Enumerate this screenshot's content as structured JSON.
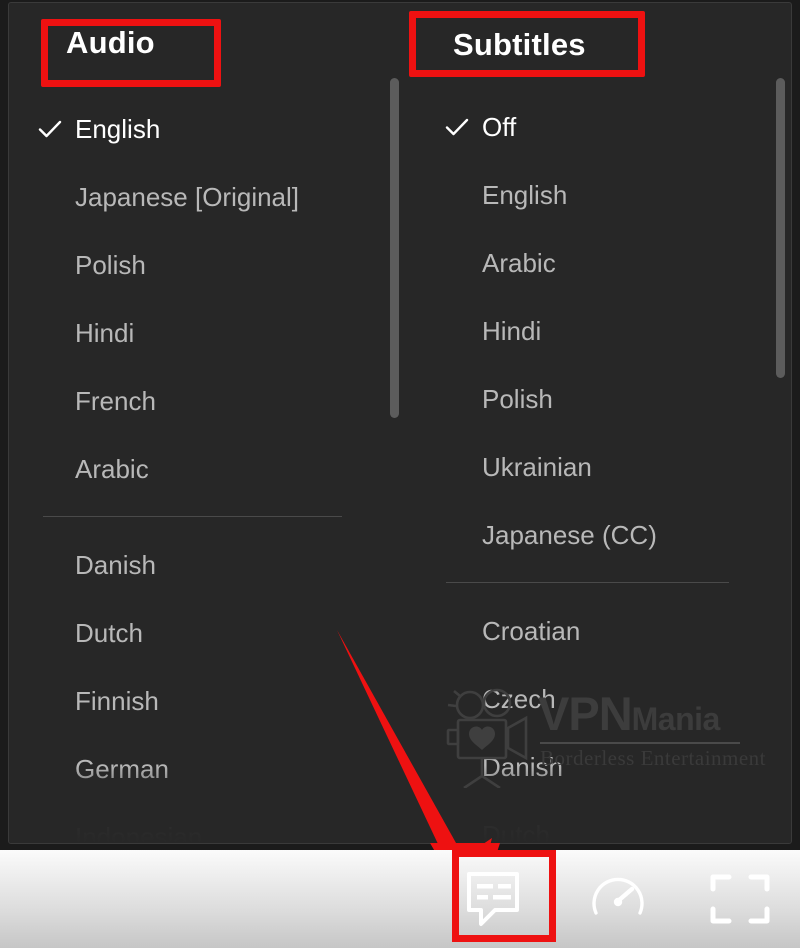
{
  "window": {
    "background_color": "#1b1b1b",
    "panel_color": "#272727",
    "accent_color": "#ee1111"
  },
  "audio_panel": {
    "title": "Audio",
    "selected": "English",
    "primary_options": [
      {
        "label": "English",
        "selected": true
      },
      {
        "label": "Japanese [Original]",
        "selected": false
      },
      {
        "label": "Polish",
        "selected": false
      },
      {
        "label": "Hindi",
        "selected": false
      },
      {
        "label": "French",
        "selected": false
      },
      {
        "label": "Arabic",
        "selected": false
      }
    ],
    "secondary_options": [
      {
        "label": "Danish",
        "selected": false,
        "faded": false
      },
      {
        "label": "Dutch",
        "selected": false,
        "faded": false
      },
      {
        "label": "Finnish",
        "selected": false,
        "faded": false
      },
      {
        "label": "German",
        "selected": false,
        "faded": false
      },
      {
        "label": "Indonesian",
        "selected": false,
        "faded": true
      }
    ]
  },
  "subtitles_panel": {
    "title": "Subtitles",
    "selected": "Off",
    "primary_options": [
      {
        "label": "Off",
        "selected": true
      },
      {
        "label": "English",
        "selected": false
      },
      {
        "label": "Arabic",
        "selected": false
      },
      {
        "label": "Hindi",
        "selected": false
      },
      {
        "label": "Polish",
        "selected": false
      },
      {
        "label": "Ukrainian",
        "selected": false
      },
      {
        "label": "Japanese (CC)",
        "selected": false
      }
    ],
    "secondary_options": [
      {
        "label": "Croatian",
        "selected": false,
        "faded": false
      },
      {
        "label": "Czech",
        "selected": false,
        "faded": false
      },
      {
        "label": "Danish",
        "selected": false,
        "faded": false
      },
      {
        "label": "Dutch",
        "selected": false,
        "faded": true
      }
    ]
  },
  "watermark": {
    "brand_primary": "VPN",
    "brand_secondary": "Mania",
    "tagline": "Borderless Entertainment",
    "icon": "movie-camera-heart-icon"
  },
  "control_bar": {
    "buttons": [
      {
        "name": "subtitles-button",
        "icon": "subtitles-icon",
        "highlighted": true
      },
      {
        "name": "playback-speed-button",
        "icon": "speedometer-icon",
        "highlighted": false
      },
      {
        "name": "fullscreen-button",
        "icon": "fullscreen-icon",
        "highlighted": false
      }
    ]
  },
  "annotations": {
    "audio_title_box": "red-highlight-box",
    "subtitles_title_box": "red-highlight-box",
    "subtitles_button_box": "red-highlight-box",
    "arrow": "red-pointer-arrow"
  }
}
